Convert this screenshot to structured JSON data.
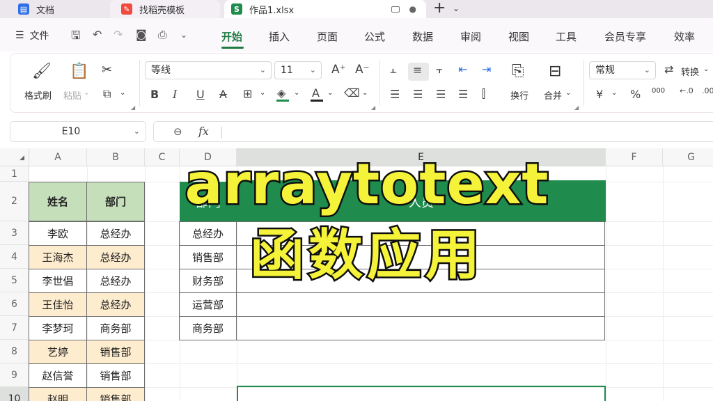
{
  "tabs": [
    {
      "label": "文档",
      "icon": "doc-icon",
      "color": "#2f6fe8"
    },
    {
      "label": "找稻壳模板",
      "icon": "docer-icon",
      "color": "#ef4b3f"
    },
    {
      "label": "作品1.xlsx",
      "icon": "sheet-icon",
      "color": "#1f8c4e",
      "icon_text": "S"
    }
  ],
  "menubar": {
    "file_label": "文件",
    "tabs": [
      "开始",
      "插入",
      "页面",
      "公式",
      "数据",
      "审阅",
      "视图",
      "工具",
      "会员专享",
      "效率"
    ],
    "active_tab": "开始"
  },
  "ribbon": {
    "format_painter": "格式刷",
    "paste": "粘贴",
    "font_name": "等线",
    "font_size": "11",
    "wrap": "换行",
    "merge": "合并",
    "number_format": "常规",
    "convert": "转换",
    "currency_symbol": "¥",
    "percent_symbol": "%",
    "thousands_symbol": "000"
  },
  "formula_bar": {
    "cell_ref": "E10",
    "fx_label": "fx",
    "formula": ""
  },
  "grid": {
    "columns": [
      "A",
      "B",
      "C",
      "D",
      "E",
      "F",
      "G"
    ],
    "rows": [
      "1",
      "2",
      "3",
      "4",
      "5",
      "6",
      "7",
      "8",
      "9",
      "10"
    ],
    "table1": {
      "headers": [
        "姓名",
        "部门"
      ],
      "rows": [
        [
          "李欧",
          "总经办"
        ],
        [
          "王海杰",
          "总经办"
        ],
        [
          "李世倡",
          "总经办"
        ],
        [
          "王佳怡",
          "总经办"
        ],
        [
          "李梦珂",
          "商务部"
        ],
        [
          "艺婷",
          "销售部"
        ],
        [
          "赵信誉",
          "销售部"
        ],
        [
          "赵明",
          "销售部"
        ]
      ]
    },
    "table2": {
      "headers": [
        "部门",
        "人员"
      ],
      "rows": [
        "总经办",
        "销售部",
        "财务部",
        "运营部",
        "商务部"
      ]
    }
  },
  "overlay": {
    "line1": "arraytotext",
    "line2": "函数应用"
  },
  "colors": {
    "accent": "#1f7a43",
    "header_green": "#1f8c4e",
    "name_header": "#c6dfbb",
    "alt_row": "#fdecce",
    "overlay_text": "#f5f23a"
  }
}
